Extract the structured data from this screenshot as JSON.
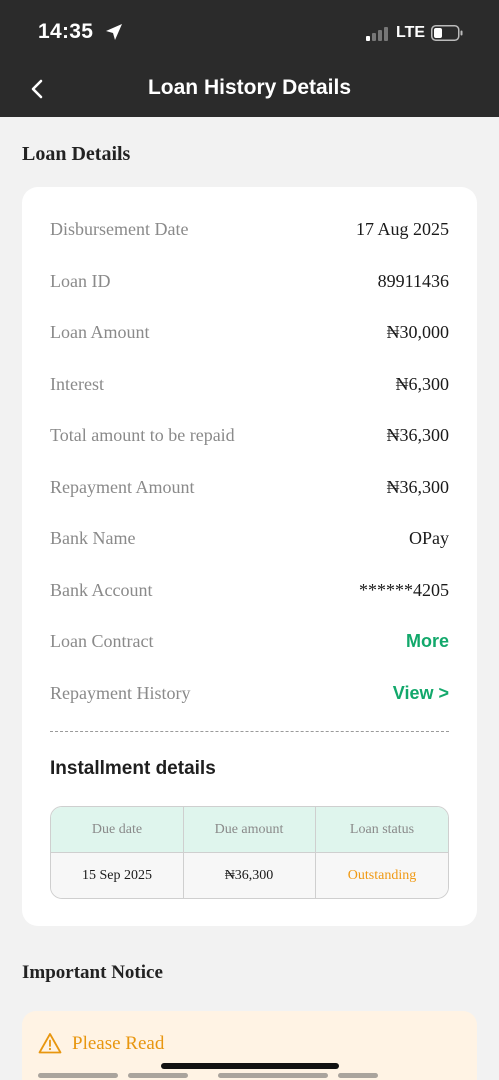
{
  "status_bar": {
    "time": "14:35",
    "network": "LTE",
    "icons": [
      "location-arrow-icon",
      "signal-icon",
      "battery-icon"
    ]
  },
  "header": {
    "title": "Loan History Details",
    "back_icon": "chevron-left-icon"
  },
  "loan_details": {
    "section_title": "Loan Details",
    "rows": [
      {
        "label": "Disbursement Date",
        "value": "17 Aug 2025"
      },
      {
        "label": "Loan ID",
        "value": "89911436"
      },
      {
        "label": "Loan Amount",
        "value": "₦30,000"
      },
      {
        "label": "Interest",
        "value": "₦6,300"
      },
      {
        "label": "Total amount to be repaid",
        "value": "₦36,300"
      },
      {
        "label": "Repayment Amount",
        "value": "₦36,300"
      },
      {
        "label": "Bank Name",
        "value": "OPay"
      },
      {
        "label": "Bank Account",
        "value": "******4205"
      },
      {
        "label": "Loan Contract",
        "link": "More"
      },
      {
        "label": "Repayment History",
        "link": "View >"
      }
    ]
  },
  "installment": {
    "title": "Installment details",
    "columns": [
      "Due date",
      "Due amount",
      "Loan status"
    ],
    "rows": [
      [
        "15 Sep 2025",
        "₦36,300",
        "Outstanding"
      ]
    ]
  },
  "notice": {
    "section_title": "Important Notice",
    "title": "Please Read",
    "icon": "warning-triangle-icon"
  },
  "colors": {
    "header_bg": "#2b2b2b",
    "accent_green": "#12a86b",
    "status_orange": "#f09a14",
    "table_header_bg": "#dff5ed",
    "notice_bg": "#fff3e4"
  }
}
